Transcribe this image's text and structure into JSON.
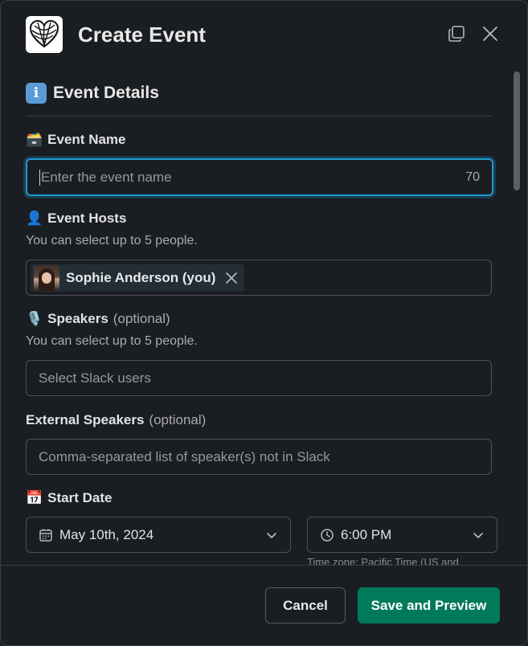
{
  "modal": {
    "title": "Create Event",
    "icons": {
      "app": "heart-logo-icon",
      "copy": "copy-icon",
      "close": "close-icon"
    }
  },
  "section": {
    "emoji": "ℹ️",
    "title": "Event Details"
  },
  "event_name": {
    "emoji": "🗃️",
    "label": "Event Name",
    "placeholder": "Enter the event name",
    "counter": "70"
  },
  "event_hosts": {
    "emoji": "👤",
    "label": "Event Hosts",
    "hint": "You can select up to 5 people.",
    "selected": [
      {
        "name": "Sophie Anderson (you)"
      }
    ]
  },
  "speakers": {
    "emoji": "🎙️",
    "label": "Speakers",
    "optional": "(optional)",
    "hint": "You can select up to 5 people.",
    "placeholder": "Select Slack users"
  },
  "external_speakers": {
    "label": "External Speakers",
    "optional": "(optional)",
    "placeholder": "Comma-separated list of speaker(s) not in Slack"
  },
  "start_date": {
    "emoji": "📅",
    "label": "Start Date",
    "date": "May 10th, 2024",
    "time": "6:00 PM",
    "timezone_note": "Time zone: Pacific Time (US and"
  },
  "footer": {
    "cancel": "Cancel",
    "save": "Save and Preview"
  },
  "colors": {
    "accent": "#1d9bd1",
    "primary_button": "#007a5a",
    "background": "#1a1d21"
  }
}
